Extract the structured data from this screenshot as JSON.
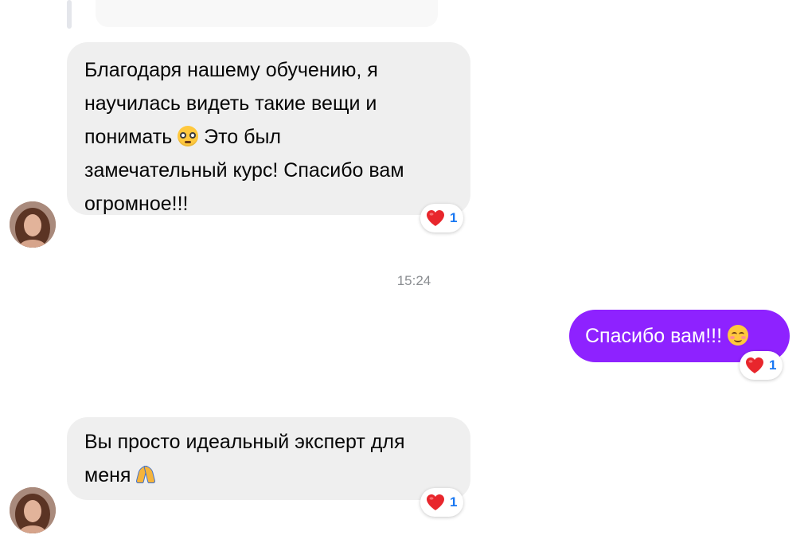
{
  "messages": [
    {
      "direction": "incoming",
      "lines": [
        "Благодаря нашему обучению, я",
        "научилась видеть такие вещи и",
        "понимать",
        "Это был",
        "замечательный курс! Спасибо вам",
        "огромное!!!"
      ],
      "emoji": "nerd-face-icon",
      "reaction": {
        "icon": "heart",
        "count": "1"
      }
    },
    {
      "direction": "outgoing",
      "text": "Спасибо вам!!!",
      "emoji": "smiling-face-icon",
      "reaction": {
        "icon": "heart",
        "count": "1"
      }
    },
    {
      "direction": "incoming",
      "lines": [
        "Вы просто идеальный эксперт для",
        "меня"
      ],
      "emoji": "folded-hands-icon",
      "reaction": {
        "icon": "heart",
        "count": "1"
      }
    }
  ],
  "timestamp": "15:24",
  "colors": {
    "outgoing_bubble": "#8e22ff",
    "incoming_bubble": "#efefef",
    "reaction_count": "#1877f2",
    "heart": "#e8262c"
  }
}
